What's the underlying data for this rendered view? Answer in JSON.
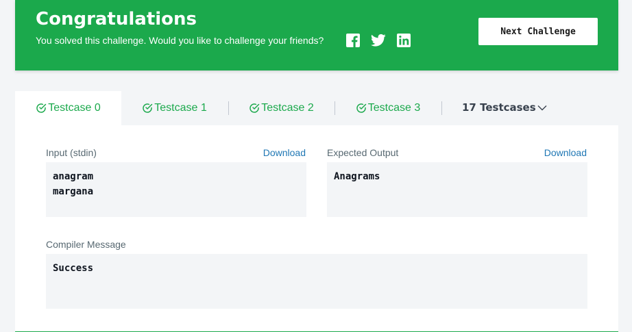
{
  "banner": {
    "title": "Congratulations",
    "subtitle": "You solved this challenge. Would you like to challenge your friends?",
    "share_icons": [
      "facebook-icon",
      "twitter-icon",
      "linkedin-icon"
    ],
    "next_button": "Next Challenge",
    "color": "#1ba94c"
  },
  "tabs": {
    "items": [
      {
        "label": "Testcase 0",
        "active": true
      },
      {
        "label": "Testcase 1",
        "active": false
      },
      {
        "label": "Testcase 2",
        "active": false
      },
      {
        "label": "Testcase 3",
        "active": false
      }
    ],
    "more_label": "17 Testcases"
  },
  "input": {
    "label": "Input (stdin)",
    "download": "Download",
    "lines": [
      "anagram",
      "margana"
    ]
  },
  "expected": {
    "label": "Expected Output",
    "download": "Download",
    "lines": [
      "Anagrams"
    ]
  },
  "compiler": {
    "label": "Compiler Message",
    "lines": [
      "Success"
    ]
  }
}
